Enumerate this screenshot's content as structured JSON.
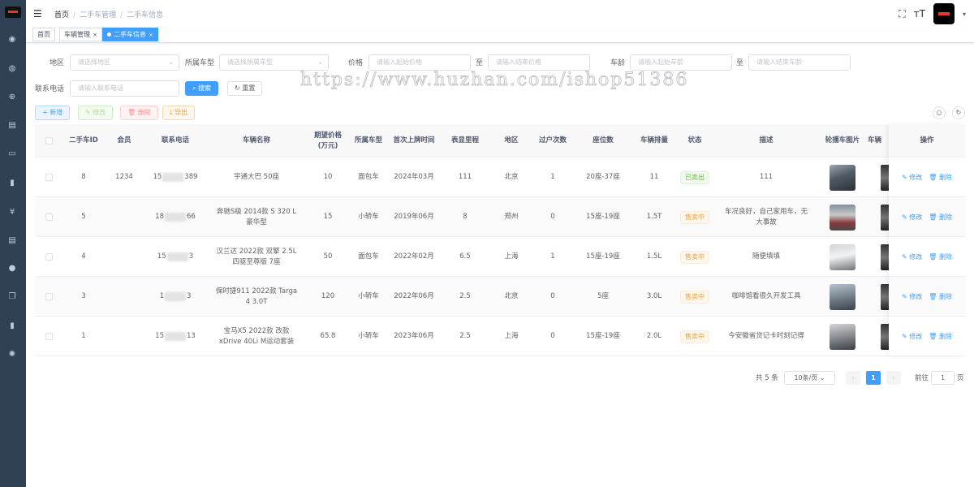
{
  "breadcrumb": [
    "首页",
    "二手车管理",
    "二手车信息"
  ],
  "tags": [
    {
      "label": "首页"
    },
    {
      "label": "车辆管理"
    },
    {
      "label": "二手车信息"
    }
  ],
  "search": {
    "region_label": "地区",
    "region_placeholder": "请选择地区",
    "type_label": "所属车型",
    "type_placeholder": "请选择所属车型",
    "price_label": "价格",
    "price_start_placeholder": "请输入起始价格",
    "price_to": "至",
    "price_end_placeholder": "请输入结束价格",
    "age_label": "车龄",
    "age_start_placeholder": "请输入起始车龄",
    "age_to": "至",
    "age_end_placeholder": "请输入结束车龄",
    "phone_label": "联系电话",
    "phone_placeholder": "请输入联系电话",
    "search_button": "搜索",
    "reset_button": "重置"
  },
  "toolbar": {
    "add": "新增",
    "edit": "修改",
    "delete": "删除",
    "export": "导出"
  },
  "watermark": "https://www.huzhan.com/ishop51386",
  "table": {
    "headers": {
      "id": "二手车ID",
      "member": "会员",
      "phone": "联系电话",
      "name": "车辆名称",
      "price": "期望价格(万元)",
      "type": "所属车型",
      "reg": "首次上牌时间",
      "mileage": "表显里程",
      "region": "地区",
      "transfers": "过户次数",
      "seats": "座位数",
      "displacement": "车辆排量",
      "status": "状态",
      "desc": "描述",
      "carousel": "轮播车图片",
      "cut": "车辆",
      "ops": "操作"
    },
    "rows": [
      {
        "id": "8",
        "member": "1234",
        "phone_a": "15",
        "phone_b": "389",
        "name": "宇通大巴 50座",
        "price": "10",
        "type": "面包车",
        "reg": "2024年03月",
        "mileage": "111",
        "region": "北京",
        "transfers": "1",
        "seats": "20座-37座",
        "displacement": "11",
        "status": "已卖出",
        "status_kind": "sold",
        "desc": "111"
      },
      {
        "id": "5",
        "member": "",
        "phone_a": "18",
        "phone_b": "66",
        "name": "奔驰S级 2014款 S 320 L 豪华型",
        "price": "15",
        "type": "小轿车",
        "reg": "2019年06月",
        "mileage": "8",
        "region": "郑州",
        "transfers": "0",
        "seats": "15座-19座",
        "displacement": "1.5T",
        "status": "售卖中",
        "status_kind": "selling",
        "desc": "车况良好，自己家用车，无大事故"
      },
      {
        "id": "4",
        "member": "",
        "phone_a": "15",
        "phone_b": "3",
        "name": "汉兰达 2022款 双擎 2.5L 四驱至尊版 7座",
        "price": "50",
        "type": "面包车",
        "reg": "2022年02月",
        "mileage": "6.5",
        "region": "上海",
        "transfers": "1",
        "seats": "15座-19座",
        "displacement": "1.5L",
        "status": "售卖中",
        "status_kind": "selling",
        "desc": "随便填填"
      },
      {
        "id": "3",
        "member": "",
        "phone_a": "1",
        "phone_b": "3",
        "name": "保时捷911 2022款 Targa 4 3.0T",
        "price": "120",
        "type": "小轿车",
        "reg": "2022年06月",
        "mileage": "2.5",
        "region": "北京",
        "transfers": "0",
        "seats": "5座",
        "displacement": "3.0L",
        "status": "售卖中",
        "status_kind": "selling",
        "desc": "咖啡馆看很久开发工具"
      },
      {
        "id": "1",
        "member": "",
        "phone_a": "15",
        "phone_b": "13",
        "name": "宝马X5 2022款 改款 xDrive 40Li M运动套装",
        "price": "65.8",
        "type": "小轿车",
        "reg": "2023年06月",
        "mileage": "2.5",
        "region": "上海",
        "transfers": "0",
        "seats": "15座-19座",
        "displacement": "2.0L",
        "status": "售卖中",
        "status_kind": "selling",
        "desc": "今安徽省贷记卡时刻记得"
      }
    ],
    "op_edit": "修改",
    "op_delete": "删除"
  },
  "pagination": {
    "total": "共 5 条",
    "page_size": "10条/页",
    "current": "1",
    "goto": "前往",
    "goto_value": "1",
    "page_unit": "页"
  },
  "colors": {
    "sidebar": "#304156",
    "primary": "#409eff",
    "sold": "#67c23a",
    "selling": "#e6a23c"
  }
}
